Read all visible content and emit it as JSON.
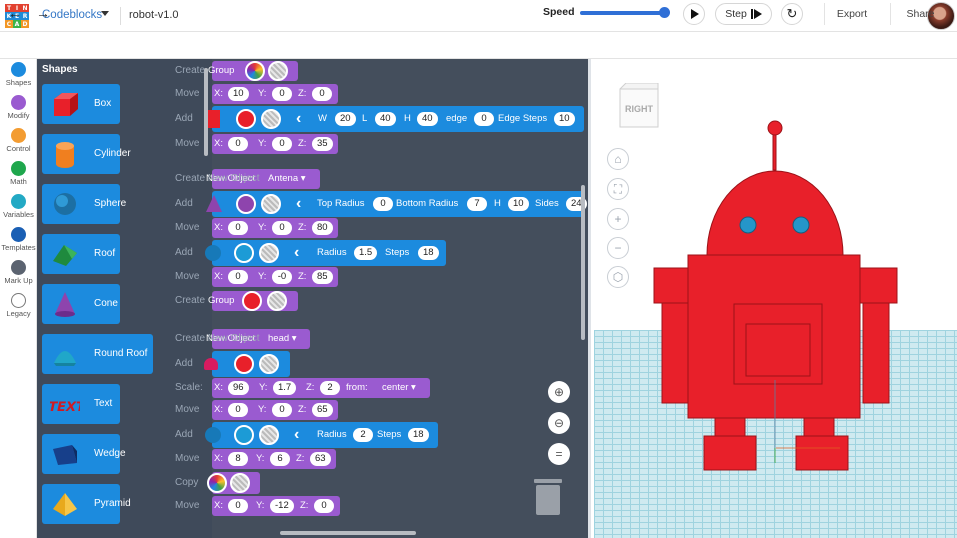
{
  "topbar": {
    "logo_letters": [
      "T",
      "I",
      "N",
      "K",
      "E",
      "R",
      "C",
      "A",
      "D"
    ],
    "logo_colors": [
      "#e2412f",
      "#e2412f",
      "#e2412f",
      "#1f8ad6",
      "#1f8ad6",
      "#1f8ad6",
      "#f29726",
      "#3bb44a",
      "#f29726"
    ],
    "app_name": "Codeblocks",
    "project_title": "robot-v1.0"
  },
  "toolbar": {
    "speed_label": "Speed",
    "speed_value": 0.9,
    "step_label": "Step",
    "export_label": "Export",
    "share_label": "Share"
  },
  "categories": [
    {
      "label": "Shapes",
      "color": "#1c8bde"
    },
    {
      "label": "Modify",
      "color": "#9a5bd0"
    },
    {
      "label": "Control",
      "color": "#f39c32"
    },
    {
      "label": "Math",
      "color": "#1fa74d"
    },
    {
      "label": "Variables",
      "color": "#23a9c4"
    },
    {
      "label": "Templates",
      "color": "#1a5fb4"
    },
    {
      "label": "Mark Up",
      "color": "#5b6370"
    },
    {
      "label": "Legacy",
      "color": "#ffffff"
    }
  ],
  "flyout": {
    "title": "Shapes",
    "items": [
      {
        "label": "Box",
        "icon": "box-icon"
      },
      {
        "label": "Cylinder",
        "icon": "cylinder-icon"
      },
      {
        "label": "Sphere",
        "icon": "sphere-icon"
      },
      {
        "label": "Roof",
        "icon": "roof-icon"
      },
      {
        "label": "Cone",
        "icon": "cone-icon"
      },
      {
        "label": "Round Roof",
        "icon": "round-roof-icon"
      },
      {
        "label": "Text",
        "icon": "text-shape-icon"
      },
      {
        "label": "Wedge",
        "icon": "wedge-icon"
      },
      {
        "label": "Pyramid",
        "icon": "pyramid-icon"
      }
    ]
  },
  "workspace": {
    "overlay_labels": {
      "create": "Create",
      "move": "Move",
      "add": "Add",
      "create_new_object": "Create New Object",
      "scale": "Scale:",
      "copy": "Copy"
    },
    "b1": {
      "label": "Group"
    },
    "b2": {
      "x": "10",
      "y": "0",
      "z": "0"
    },
    "b3": {
      "w": "20",
      "l": "40",
      "h": "40",
      "edge": "0",
      "edge_steps": "10",
      "lbl_w": "W",
      "lbl_l": "L",
      "lbl_h": "H",
      "lbl_edge": "edge",
      "lbl_edge_steps": "Edge Steps"
    },
    "b4": {
      "x": "0",
      "y": "0",
      "z": "35"
    },
    "b5": {
      "label": "New Object",
      "name": "Antena"
    },
    "b6": {
      "lbl_top": "Top Radius",
      "top_radius": "0",
      "lbl_bottom": "Bottom Radius",
      "bottom_radius": "7",
      "lbl_h": "H",
      "h": "10",
      "lbl_sides": "Sides",
      "sides": "24"
    },
    "b7": {
      "x": "0",
      "y": "0",
      "z": "80"
    },
    "b8": {
      "lbl_radius": "Radius",
      "radius": "1.5",
      "lbl_steps": "Steps",
      "steps": "18"
    },
    "b9": {
      "x": "0",
      "y": "-0",
      "z": "85"
    },
    "b10": {
      "label": "Group"
    },
    "b11": {
      "label": "New Object",
      "name": "head"
    },
    "b12": {
      "x": "96",
      "y": "1.7",
      "z": "2",
      "lbl_from": "from:",
      "from": "center"
    },
    "b13": {
      "x": "0",
      "y": "0",
      "z": "65"
    },
    "b14": {
      "lbl_radius": "Radius",
      "radius": "2",
      "lbl_steps": "Steps",
      "steps": "18"
    },
    "b15": {
      "x": "8",
      "y": "6",
      "z": "63"
    },
    "b16": {
      "x": "0",
      "y": "-12",
      "z": "0"
    },
    "axis_x": "X:",
    "axis_y": "Y:",
    "axis_z": "Z:"
  },
  "viewport": {
    "viewcube_face": "RIGHT",
    "robot_color": "#e8202a",
    "eye_color": "#2596c9"
  }
}
